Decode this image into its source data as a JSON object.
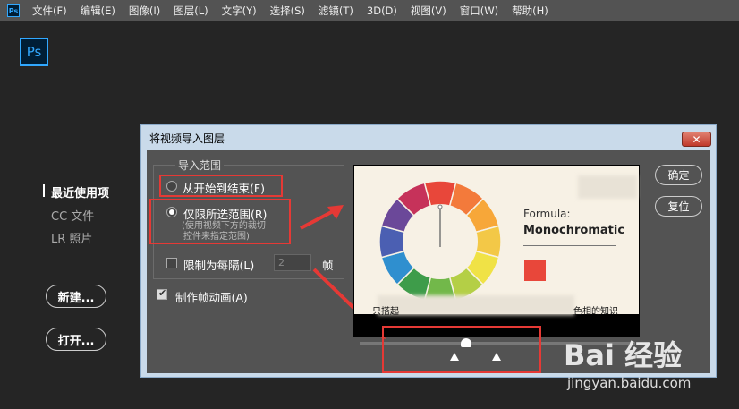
{
  "menubar": {
    "app_icon_text": "Ps",
    "items": [
      "文件(F)",
      "编辑(E)",
      "图像(I)",
      "图层(L)",
      "文字(Y)",
      "选择(S)",
      "滤镜(T)",
      "3D(D)",
      "视图(V)",
      "窗口(W)",
      "帮助(H)"
    ]
  },
  "home": {
    "logo_text": "Ps",
    "nav": [
      "最近使用项",
      "CC 文件",
      "LR 照片"
    ],
    "new_button": "新建...",
    "open_button": "打开..."
  },
  "dialog": {
    "title": "将视频导入图层",
    "close_icon": "close-icon",
    "range_group_title": "导入范围",
    "radio_full": "从开始到结束(F)",
    "radio_selected": "仅限所选范围(R)",
    "radio_selected_hint_line1": "(使用视频下方的裁切",
    "radio_selected_hint_line2": "控件来指定范围)",
    "limit_every_label": "限制为每隔(L)",
    "limit_every_value": "2",
    "limit_every_unit": "帧",
    "make_animation_label": "制作帧动画(A)",
    "make_animation_checked": true,
    "ok_button": "确定",
    "reset_button": "复位"
  },
  "preview": {
    "formula_label": "Formula:",
    "formula_value": "Monochromatic",
    "caption_left": "只搭起",
    "caption_right": "色相的知识",
    "swatch_color": "#e8473a",
    "wheel_colors": [
      "#e8473a",
      "#f37a3b",
      "#f7a739",
      "#f3c847",
      "#f0e246",
      "#b4cf46",
      "#72b84a",
      "#3e9c4a",
      "#2f8fcf",
      "#4b5fb2",
      "#6b4899",
      "#c6325a"
    ]
  },
  "watermark": {
    "brand": "Bai 经验",
    "url": "jingyan.baidu.com"
  }
}
